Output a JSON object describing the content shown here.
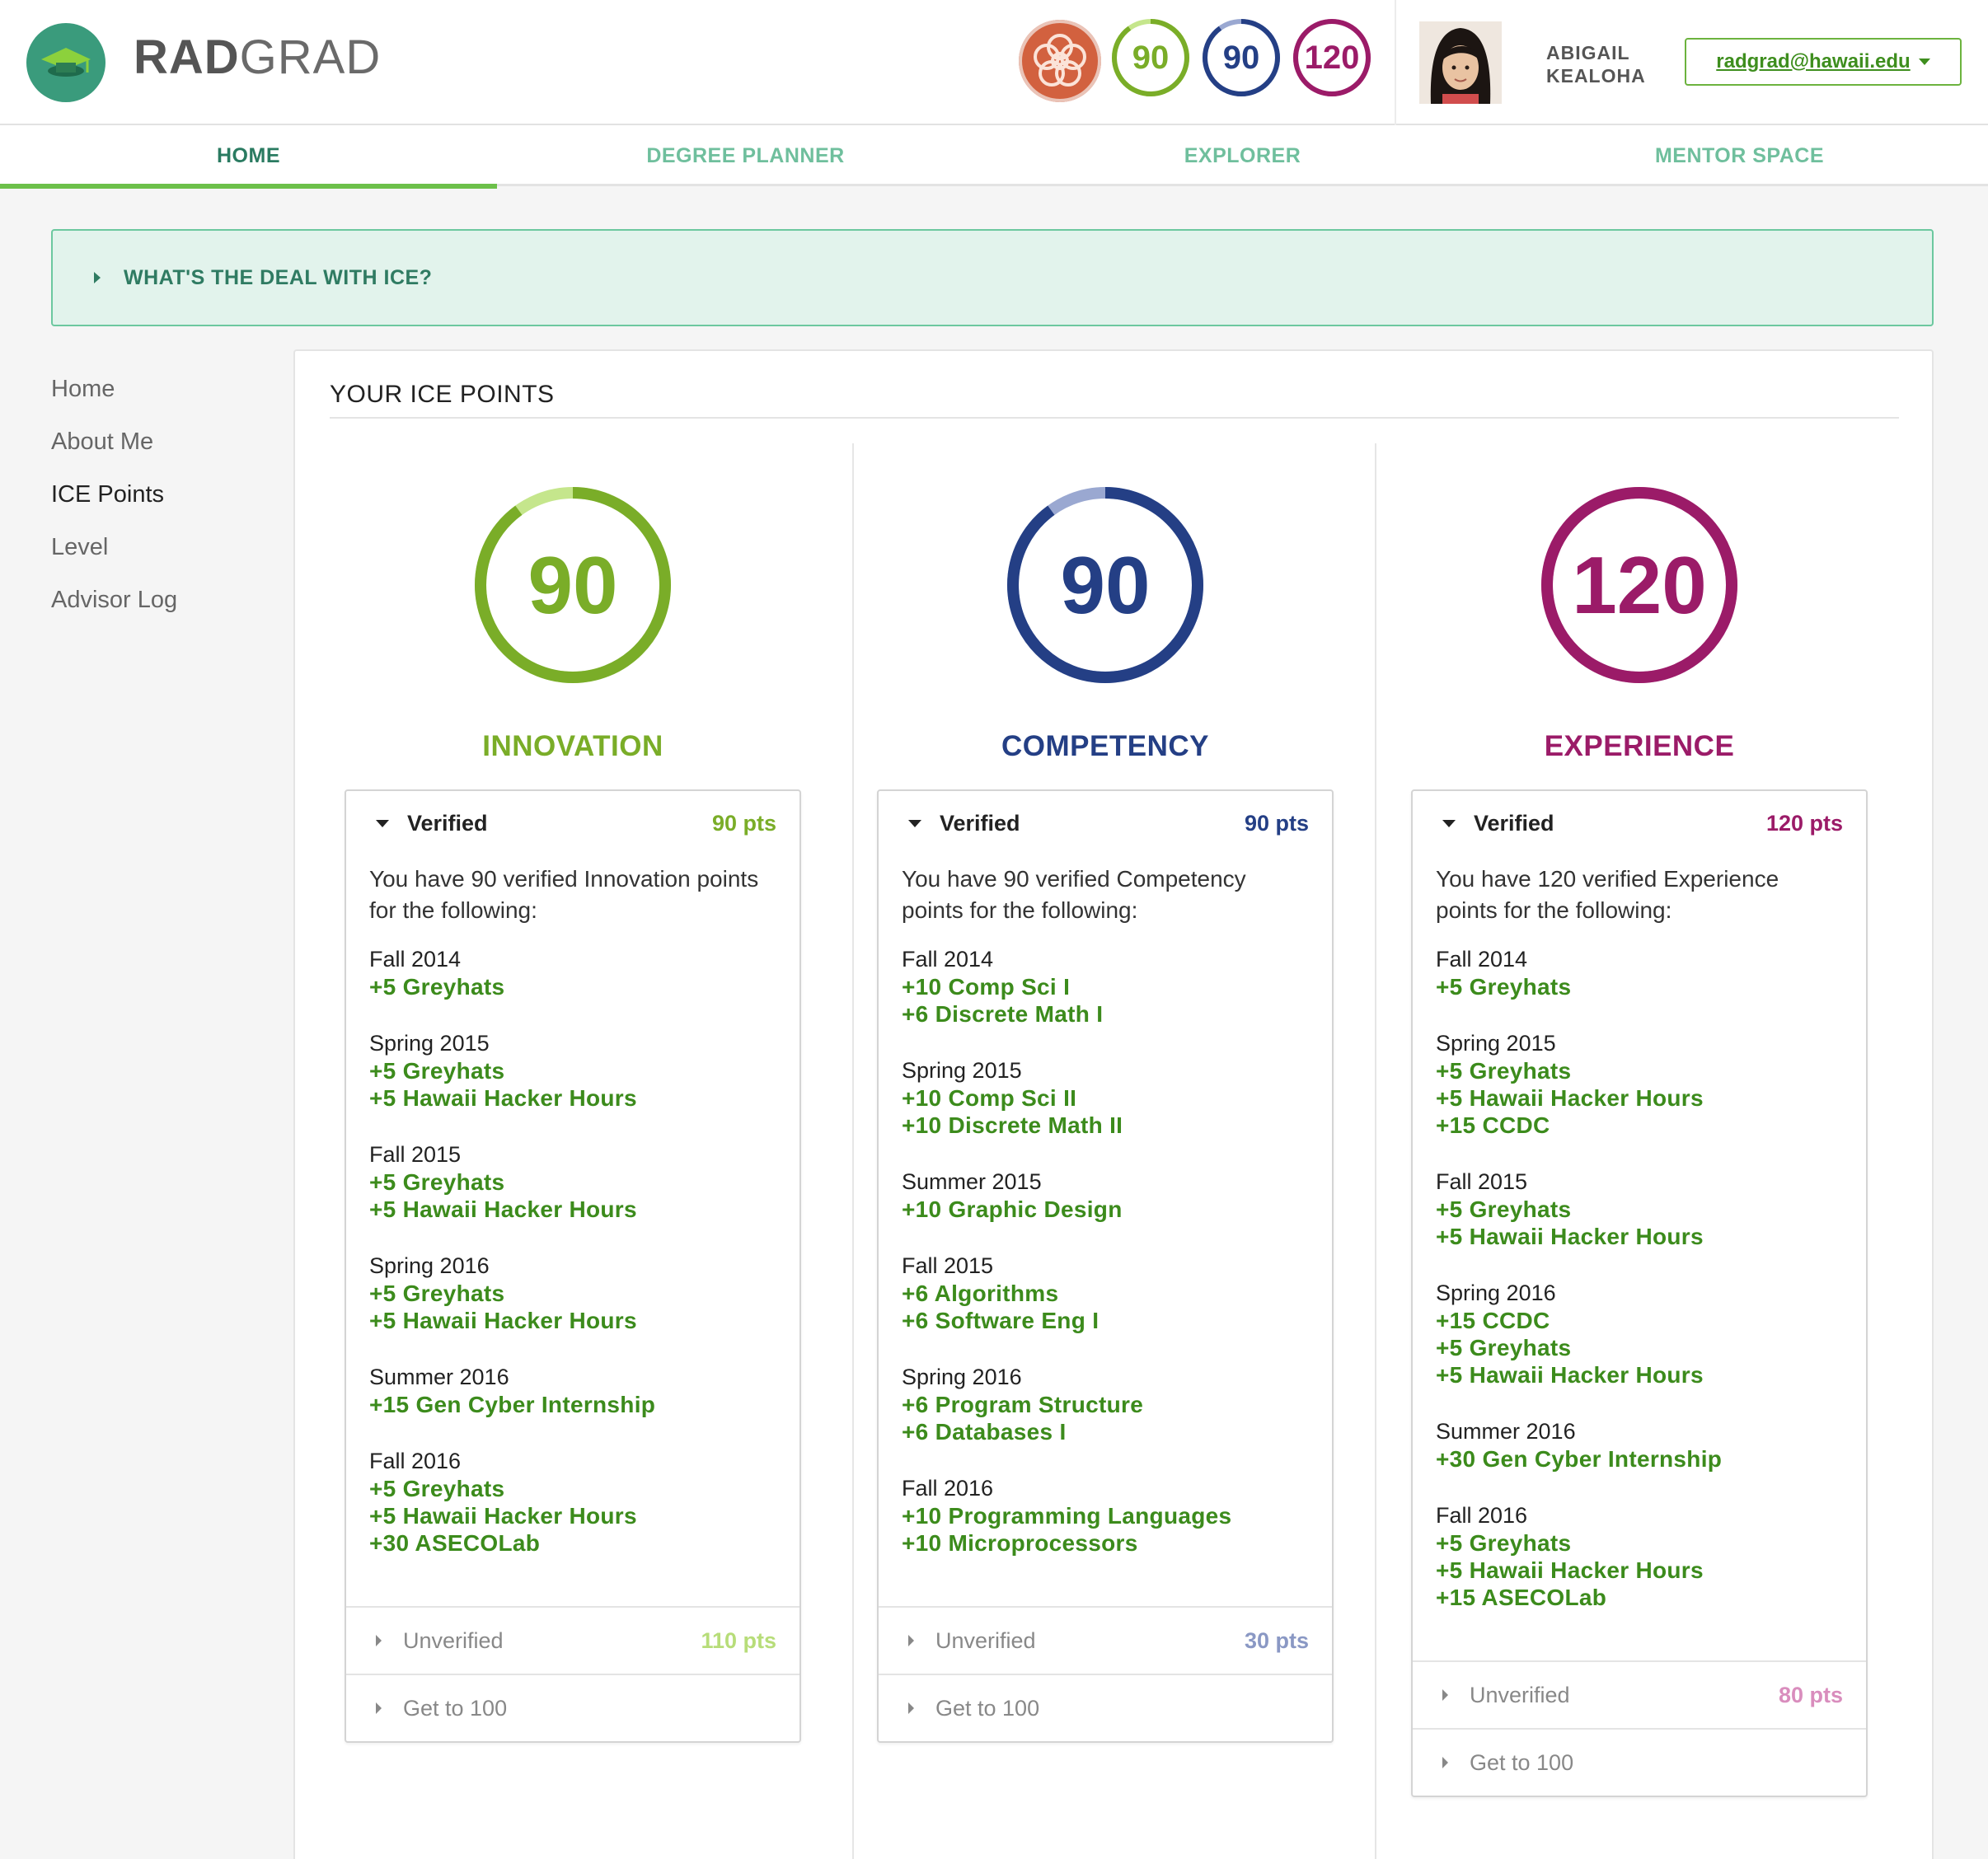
{
  "brand": {
    "name_bold": "RAD",
    "name_rest": "GRAD",
    "accent": "#3a9b7c"
  },
  "header": {
    "level_icon": "level-flower-icon",
    "mini_scores": [
      {
        "value": "90",
        "color": "#7aad28",
        "fill": 0.9
      },
      {
        "value": "90",
        "color": "#243f85",
        "fill": 0.9
      },
      {
        "value": "120",
        "color": "#9b1b68",
        "fill": 1.0
      }
    ],
    "user_first": "ABIGAIL",
    "user_last": "KEALOHA",
    "user_email": "radgrad@hawaii.edu"
  },
  "nav": [
    "HOME",
    "DEGREE PLANNER",
    "EXPLORER",
    "MENTOR SPACE"
  ],
  "banner": "WHAT'S THE DEAL WITH ICE?",
  "side_menu": [
    "Home",
    "About Me",
    "ICE Points",
    "Level",
    "Advisor Log"
  ],
  "panel_title": "YOUR ICE POINTS",
  "columns": [
    {
      "score": "90",
      "title": "INNOVATION",
      "color": "#7aad28",
      "light": "#c5e68c",
      "fill": 0.9,
      "verified_label": "Verified",
      "verified_pts": "90 pts",
      "intro": "You have 90 verified Innovation points for the following:",
      "semesters": [
        {
          "name": "Fall 2014",
          "items": [
            "+5 Greyhats"
          ]
        },
        {
          "name": "Spring 2015",
          "items": [
            "+5 Greyhats",
            "+5 Hawaii Hacker Hours"
          ]
        },
        {
          "name": "Fall 2015",
          "items": [
            "+5 Greyhats",
            "+5 Hawaii Hacker Hours"
          ]
        },
        {
          "name": "Spring 2016",
          "items": [
            "+5 Greyhats",
            "+5 Hawaii Hacker Hours"
          ]
        },
        {
          "name": "Summer 2016",
          "items": [
            "+15 Gen Cyber Internship"
          ]
        },
        {
          "name": "Fall 2016",
          "items": [
            "+5 Greyhats",
            "+5 Hawaii Hacker Hours",
            "+30 ASECOLab"
          ]
        }
      ],
      "unverified_label": "Unverified",
      "unverified_pts": "110 pts",
      "unverified_color": "#b7dd79",
      "goal_label": "Get to 100"
    },
    {
      "score": "90",
      "title": "COMPETENCY",
      "color": "#243f85",
      "light": "#9aa8d1",
      "fill": 0.9,
      "verified_label": "Verified",
      "verified_pts": "90 pts",
      "intro": "You have 90 verified Competency points for the following:",
      "semesters": [
        {
          "name": "Fall 2014",
          "items": [
            "+10 Comp Sci I",
            "+6 Discrete Math I"
          ]
        },
        {
          "name": "Spring 2015",
          "items": [
            "+10 Comp Sci II",
            "+10 Discrete Math II"
          ]
        },
        {
          "name": "Summer 2015",
          "items": [
            "+10 Graphic Design"
          ]
        },
        {
          "name": "Fall 2015",
          "items": [
            "+6 Algorithms",
            "+6 Software Eng I"
          ]
        },
        {
          "name": "Spring 2016",
          "items": [
            "+6 Program Structure",
            "+6 Databases I"
          ]
        },
        {
          "name": "Fall 2016",
          "items": [
            "+10 Programming Languages",
            "+10 Microprocessors"
          ]
        }
      ],
      "unverified_label": "Unverified",
      "unverified_pts": "30 pts",
      "unverified_color": "#8a98c4",
      "goal_label": "Get to 100"
    },
    {
      "score": "120",
      "title": "EXPERIENCE",
      "color": "#9b1b68",
      "light": "#d989b8",
      "fill": 1.0,
      "verified_label": "Verified",
      "verified_pts": "120 pts",
      "intro": "You have 120 verified Experience points for the following:",
      "semesters": [
        {
          "name": "Fall 2014",
          "items": [
            "+5 Greyhats"
          ]
        },
        {
          "name": "Spring 2015",
          "items": [
            "+5 Greyhats",
            "+5 Hawaii Hacker Hours",
            "+15 CCDC"
          ]
        },
        {
          "name": "Fall 2015",
          "items": [
            "+5 Greyhats",
            "+5 Hawaii Hacker Hours"
          ]
        },
        {
          "name": "Spring 2016",
          "items": [
            "+15 CCDC",
            "+5 Greyhats",
            "+5 Hawaii Hacker Hours"
          ]
        },
        {
          "name": "Summer 2016",
          "items": [
            "+30 Gen Cyber Internship"
          ]
        },
        {
          "name": "Fall 2016",
          "items": [
            "+5 Greyhats",
            "+5 Hawaii Hacker Hours",
            "+15 ASECOLab"
          ]
        }
      ],
      "unverified_label": "Unverified",
      "unverified_pts": "80 pts",
      "unverified_color": "#d98dbd",
      "goal_label": "Get to 100"
    }
  ]
}
